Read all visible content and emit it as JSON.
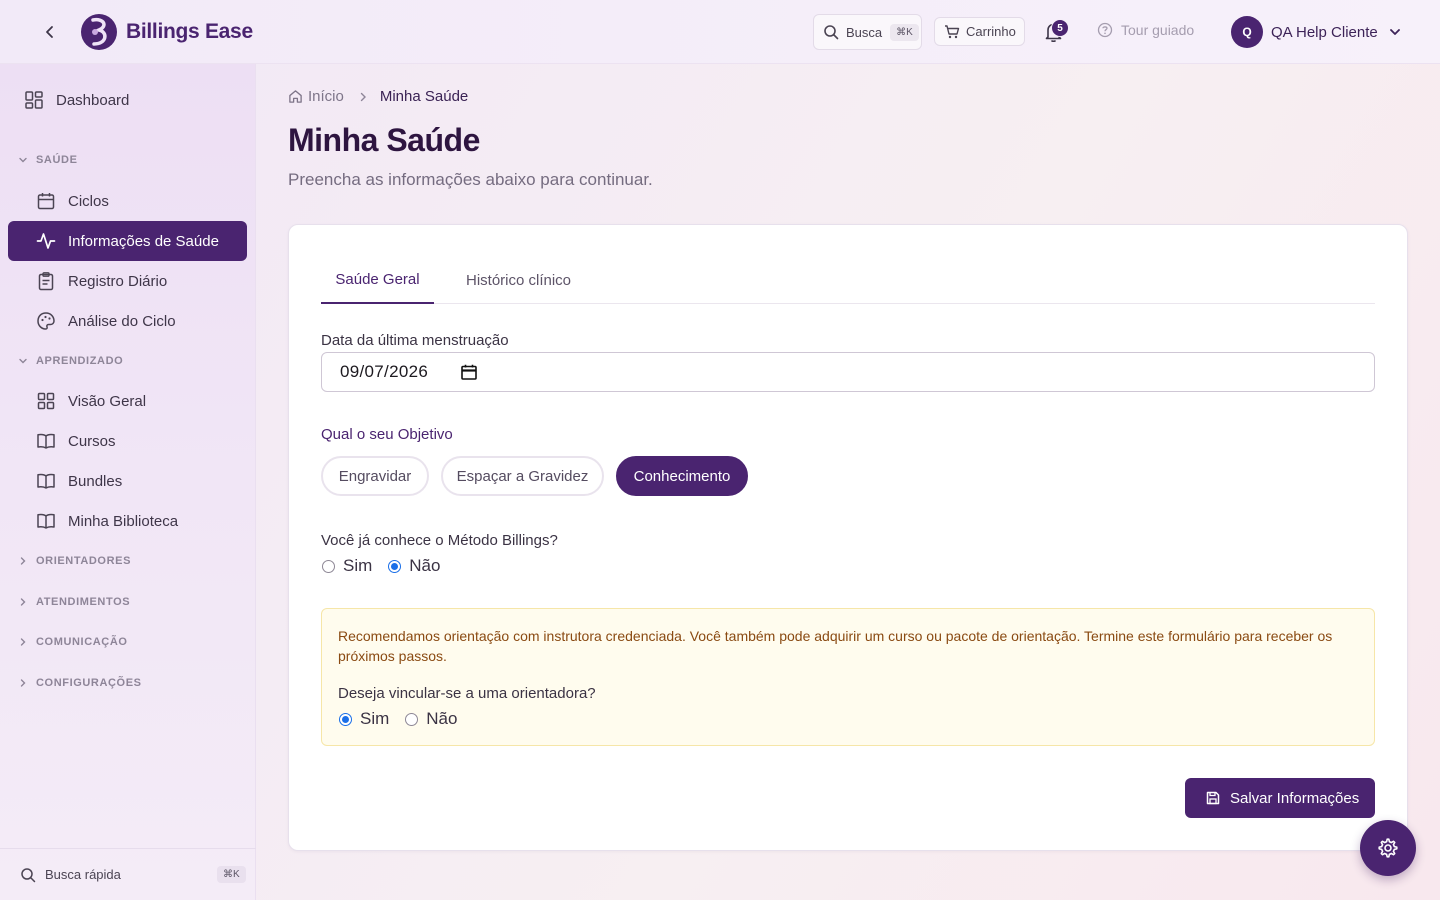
{
  "header": {
    "app_name": "Billings Ease",
    "search_label": "Busca",
    "search_shortcut": "⌘K",
    "cart_label": "Carrinho",
    "notification_count": "5",
    "tour_label": "Tour guiado",
    "user_initial": "Q",
    "user_name": "QA Help Cliente"
  },
  "sidebar": {
    "dashboard": "Dashboard",
    "sections": {
      "saude": "SAÚDE",
      "aprendizado": "APRENDIZADO",
      "orientadores": "ORIENTADORES",
      "atendimentos": "ATENDIMENTOS",
      "comunicacao": "COMUNICAÇÃO",
      "configuracoes": "CONFIGURAÇÕES"
    },
    "saude_items": [
      "Ciclos",
      "Informações de Saúde",
      "Registro Diário",
      "Análise do Ciclo"
    ],
    "aprendizado_items": [
      "Visão Geral",
      "Cursos",
      "Bundles",
      "Minha Biblioteca"
    ],
    "quick_search": "Busca rápida",
    "quick_search_shortcut": "⌘K"
  },
  "breadcrumb": {
    "home": "Início",
    "current": "Minha Saúde"
  },
  "page": {
    "title": "Minha Saúde",
    "subtitle": "Preencha as informações abaixo para continuar."
  },
  "form": {
    "tabs": [
      "Saúde Geral",
      "Histórico clínico"
    ],
    "last_period_label": "Data da última menstruação",
    "last_period_value": "09/07/2026",
    "objective_label": "Qual o seu Objetivo",
    "objectives": [
      "Engravidar",
      "Espaçar a Gravidez",
      "Conhecimento"
    ],
    "selected_objective": "Conhecimento",
    "method_question": "Você já conhece o Método Billings?",
    "method_options": [
      "Sim",
      "Não"
    ],
    "method_selected": "Não",
    "notice_text": "Recomendamos orientação com instrutora credenciada. Você também pode adquirir um curso ou pacote de orientação. Termine este formulário para receber os próximos passos.",
    "link_question": "Deseja vincular-se a uma orientadora?",
    "link_options": [
      "Sim",
      "Não"
    ],
    "link_selected": "Sim",
    "save_label": "Salvar Informações"
  },
  "colors": {
    "brand": "#4a2470",
    "notice_bg": "#fffcee",
    "notice_text": "#8a4a12",
    "radio_checked": "#1a6fe8"
  }
}
